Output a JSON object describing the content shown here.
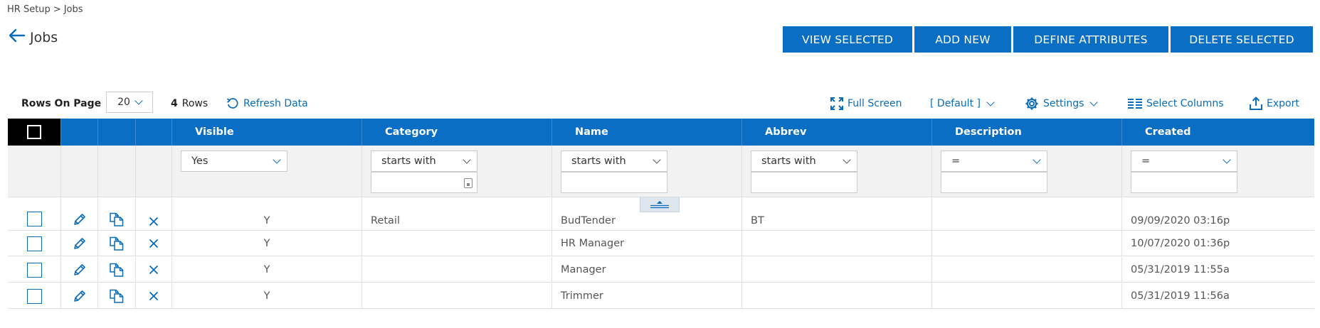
{
  "breadcrumb": {
    "parent": "HR Setup",
    "separator": ">",
    "current": "Jobs"
  },
  "page": {
    "title": "Jobs"
  },
  "actions": {
    "view_selected": "VIEW SELECTED",
    "add_new": "ADD NEW",
    "define_attributes": "DEFINE ATTRIBUTES",
    "delete_selected": "DELETE SELECTED"
  },
  "toolbar": {
    "rows_on_page_label": "Rows On Page",
    "rows_on_page_value": "20",
    "row_count": "4",
    "row_count_label": "Rows",
    "refresh": "Refresh Data",
    "full_screen": "Full Screen",
    "view_preset": "[ Default ]",
    "settings": "Settings",
    "select_columns": "Select Columns",
    "export": "Export"
  },
  "columns": {
    "visible": "Visible",
    "category": "Category",
    "name": "Name",
    "abbrev": "Abbrev",
    "description": "Description",
    "created": "Created"
  },
  "filters": {
    "visible": "Yes",
    "category": "starts with",
    "name": "starts with",
    "abbrev": "starts with",
    "description": "=",
    "created": "="
  },
  "rows": [
    {
      "visible": "Y",
      "category": "Retail",
      "name": "BudTender",
      "abbrev": "BT",
      "description": "",
      "created": "09/09/2020 03:16p"
    },
    {
      "visible": "Y",
      "category": "",
      "name": "HR Manager",
      "abbrev": "",
      "description": "",
      "created": "10/07/2020 01:36p"
    },
    {
      "visible": "Y",
      "category": "",
      "name": "Manager",
      "abbrev": "",
      "description": "",
      "created": "05/31/2019 11:55a"
    },
    {
      "visible": "Y",
      "category": "",
      "name": "Trimmer",
      "abbrev": "",
      "description": "",
      "created": "05/31/2019 11:56a"
    }
  ],
  "colors": {
    "accent": "#0a6ec4",
    "link": "#0a6bb8",
    "header_bg": "#0a6ec4",
    "filter_bg": "#f2f2f2"
  },
  "icons": [
    "back-arrow-icon",
    "refresh-icon",
    "fullscreen-icon",
    "gear-icon",
    "columns-icon",
    "export-icon",
    "pencil-icon",
    "copy-icon",
    "close-icon",
    "collapse-icon",
    "chevron-down-icon"
  ]
}
